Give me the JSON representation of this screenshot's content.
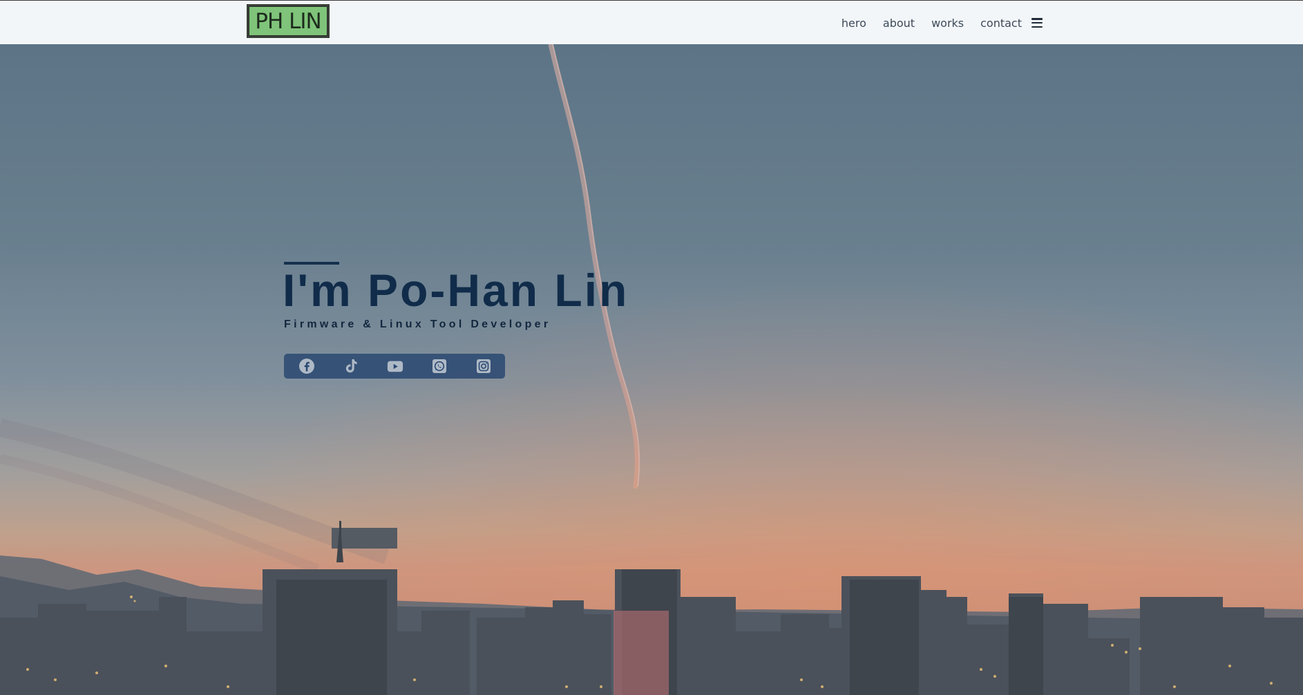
{
  "header": {
    "logo_text": "PH LIN",
    "nav": [
      {
        "label": "hero"
      },
      {
        "label": "about"
      },
      {
        "label": "works"
      },
      {
        "label": "contact"
      }
    ],
    "menu_icon": "hamburger-menu-icon"
  },
  "hero": {
    "title": "I'm Po-Han Lin",
    "subtitle": "Firmware & Linux Tool Developer",
    "social": [
      {
        "name": "facebook-icon"
      },
      {
        "name": "tiktok-icon"
      },
      {
        "name": "youtube-icon"
      },
      {
        "name": "whatsapp-icon"
      },
      {
        "name": "instagram-icon"
      }
    ]
  },
  "colors": {
    "navbar_bg": "#f3f6f9",
    "logo_green": "#7fc47a",
    "title_navy": "#102c4a",
    "social_bar_bg": "#294870"
  }
}
